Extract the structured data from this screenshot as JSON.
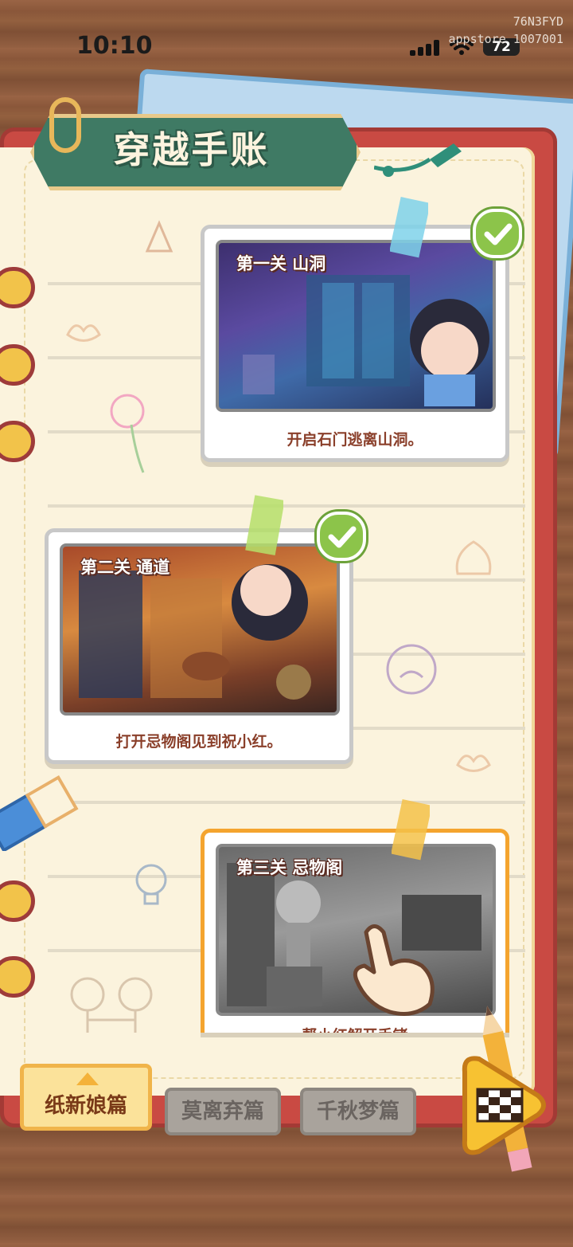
{
  "status_bar": {
    "time": "10:10",
    "battery": "72",
    "watermark_line1": "76N3FYD",
    "watermark_line2": "appstore 1007001"
  },
  "header": {
    "title": "穿越手账"
  },
  "levels": [
    {
      "label": "第一关 山洞",
      "caption": "开启石门逃离山洞。",
      "completed": true,
      "scene": "cave"
    },
    {
      "label": "第二关 通道",
      "caption": "打开忌物阁见到祝小红。",
      "completed": true,
      "scene": "corridor"
    },
    {
      "label": "第三关 忌物阁",
      "caption": "帮小红解开手铐",
      "completed": false,
      "scene": "forbidden-room"
    }
  ],
  "tabs": [
    {
      "label": "纸新娘篇",
      "active": true
    },
    {
      "label": "莫离弃篇",
      "active": false
    },
    {
      "label": "千秋梦篇",
      "active": false
    }
  ],
  "colors": {
    "accent_orange": "#f4a42e",
    "check_green": "#8cc44a",
    "title_green": "#3f7a64",
    "notebook_red": "#c94a43"
  }
}
